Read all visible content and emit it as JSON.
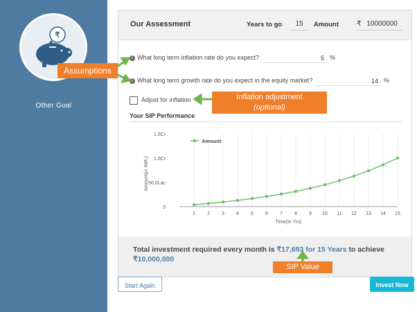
{
  "sidebar": {
    "goal_label": "Other Goal",
    "goal_icon": "piggy-bank-icon"
  },
  "assessment": {
    "title": "Our Assessment",
    "years_label": "Years to go",
    "years_value": "15",
    "amount_label": "Amount",
    "currency": "₹",
    "amount_value": "10000000"
  },
  "questions": {
    "inflation": {
      "text": "What long term inflation rate do you expect?",
      "value": "5",
      "unit": "%"
    },
    "growth": {
      "text": "What long term growth rate do you expect in the equity market?",
      "value": "14",
      "unit": "%"
    }
  },
  "adjust": {
    "label": "Adjust for inflation",
    "checked": false
  },
  "sip_title": "Your SIP Performance",
  "chart_data": {
    "type": "line",
    "x": [
      1,
      2,
      3,
      4,
      5,
      6,
      7,
      8,
      9,
      10,
      11,
      12,
      13,
      14,
      15
    ],
    "series": [
      {
        "name": "Amount",
        "color": "#6cc06c",
        "values": [
          0.018,
          0.04,
          0.066,
          0.095,
          0.128,
          0.166,
          0.209,
          0.258,
          0.314,
          0.378,
          0.451,
          0.535,
          0.63,
          0.738,
          0.862,
          1.0
        ]
      }
    ],
    "x_values": [
      0,
      1,
      2,
      3,
      4,
      5,
      6,
      7,
      8,
      9,
      10,
      11,
      12,
      13,
      14,
      15
    ],
    "yticks": [
      {
        "value": 0,
        "label": "0"
      },
      {
        "value": 0.5,
        "label": "50.0Lac"
      },
      {
        "value": 1.0,
        "label": "1.0Cr"
      },
      {
        "value": 1.5,
        "label": "1.5Cr"
      }
    ],
    "xticks": [
      "1",
      "2",
      "3",
      "4",
      "5",
      "6",
      "7",
      "8",
      "9",
      "10",
      "11",
      "12",
      "13",
      "14",
      "15"
    ],
    "ylim": [
      0,
      1.5
    ],
    "xlim": [
      0,
      15
    ],
    "xlabel": "Time(in Yrs)",
    "ylabel": "Amount(in INR,)",
    "legend": "top-left",
    "grid": "vertical"
  },
  "summary": {
    "prefix": "Total investment required every month is ",
    "amount": "₹17,693 for 15 Years",
    "middle": " to achieve ",
    "target": "₹10,000,000"
  },
  "buttons": {
    "start_again": "Start Again",
    "invest_now": "Invest Now"
  },
  "callouts": {
    "assumptions": "Assumptions",
    "inflation_adjustment": "Inflation adjustment",
    "optional": "(optional)",
    "sip_value": "SIP Value"
  },
  "colors": {
    "sidebar": "#4d7ba1",
    "invest_button": "#17b8d6",
    "callout": "#f07f2a",
    "arrow": "#6fb44a",
    "line": "#6cc06c"
  }
}
